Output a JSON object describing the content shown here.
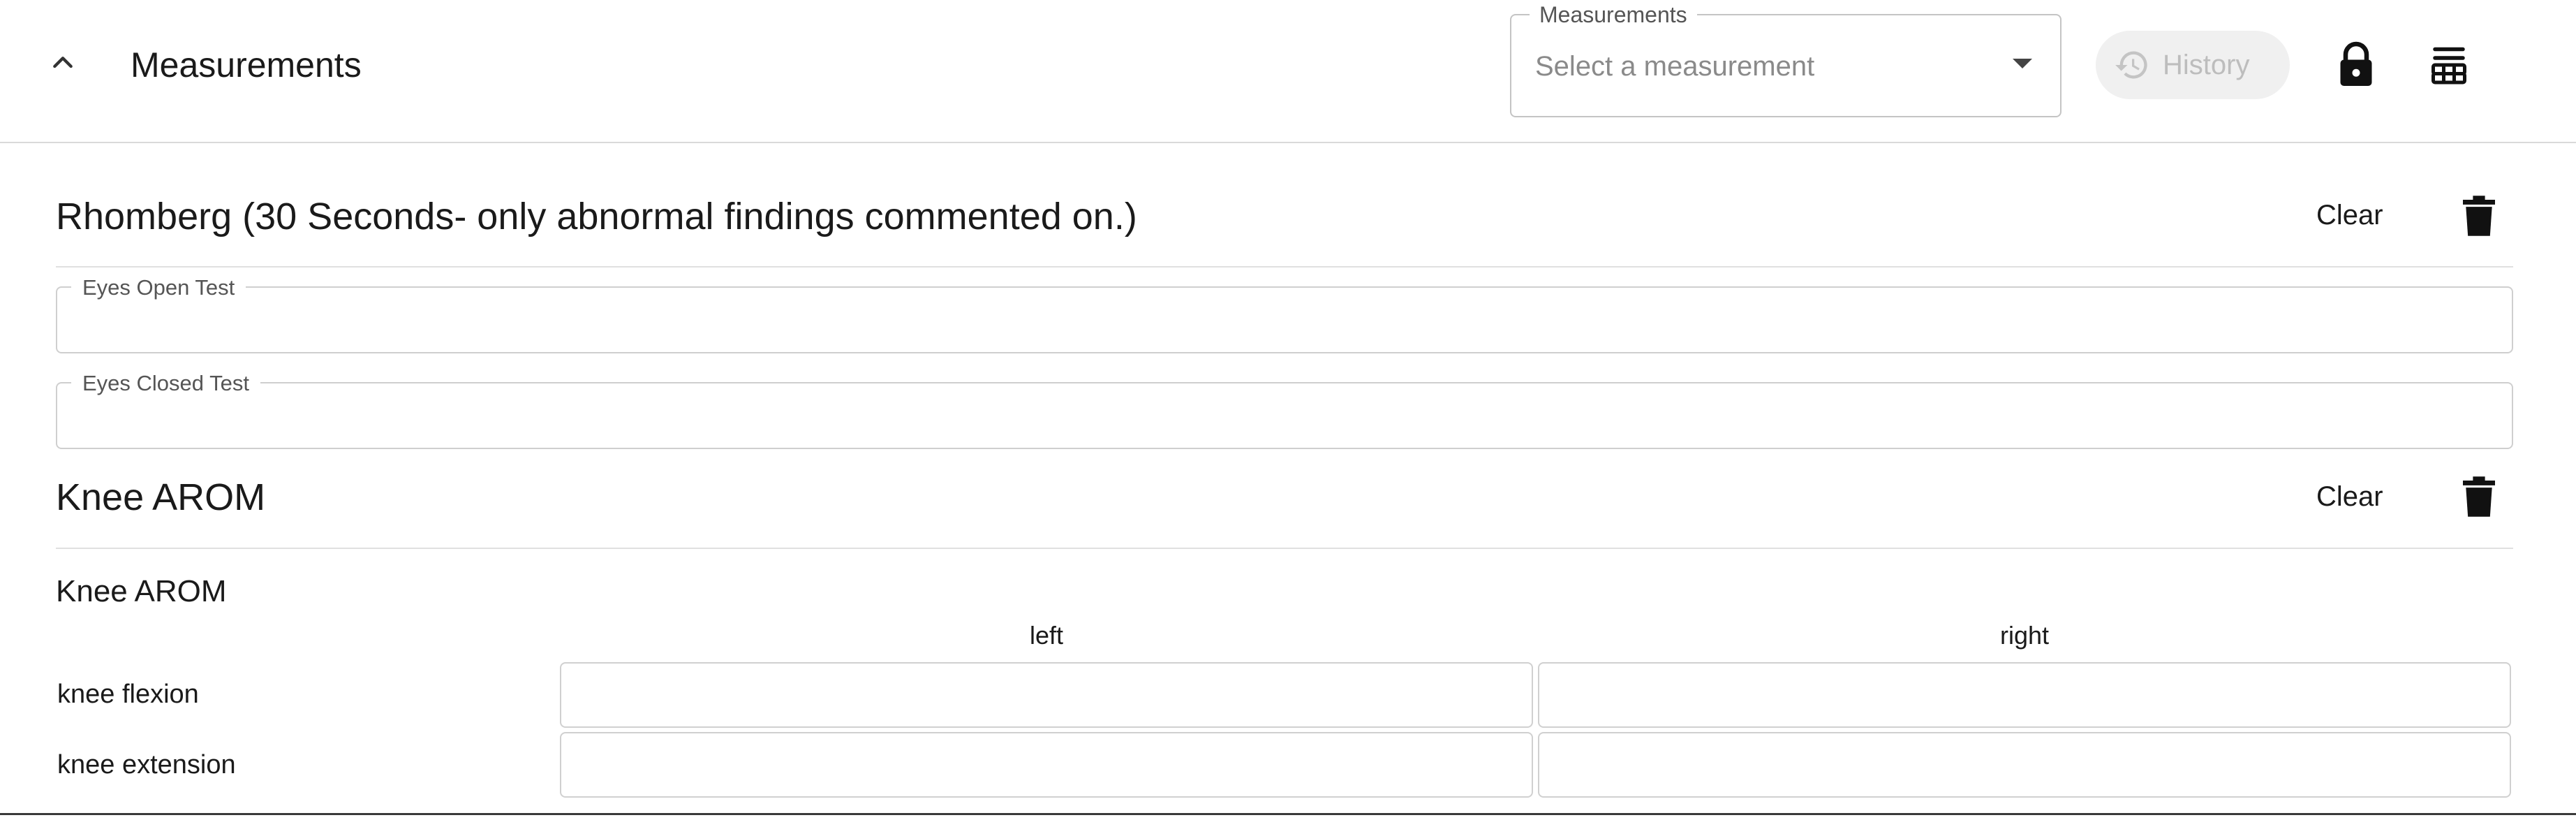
{
  "header": {
    "title": "Measurements",
    "collapse_icon": "chevron-up-icon",
    "select": {
      "legend": "Measurements",
      "placeholder": "Select a measurement"
    },
    "history_label": "History",
    "history_icon": "history-icon",
    "lock_icon": "lock-icon",
    "settings_icon": "settings-icon"
  },
  "sections": [
    {
      "title": "Rhomberg (30 Seconds- only abnormal findings commented on.)",
      "clear_label": "Clear",
      "fields": [
        {
          "label": "Eyes Open Test",
          "value": ""
        },
        {
          "label": "Eyes Closed Test",
          "value": ""
        }
      ]
    },
    {
      "title": "Knee AROM",
      "clear_label": "Clear",
      "subtitle": "Knee AROM",
      "columns": [
        "left",
        "right"
      ],
      "rows": [
        {
          "label": "knee flexion",
          "left": "",
          "right": ""
        },
        {
          "label": "knee extension",
          "left": "",
          "right": ""
        }
      ]
    }
  ],
  "colors": {
    "text": "#1a1a1a",
    "border": "#cfcfcf",
    "history_disabled_bg": "#f0f0f0",
    "history_disabled_text": "#bdbdbd"
  }
}
